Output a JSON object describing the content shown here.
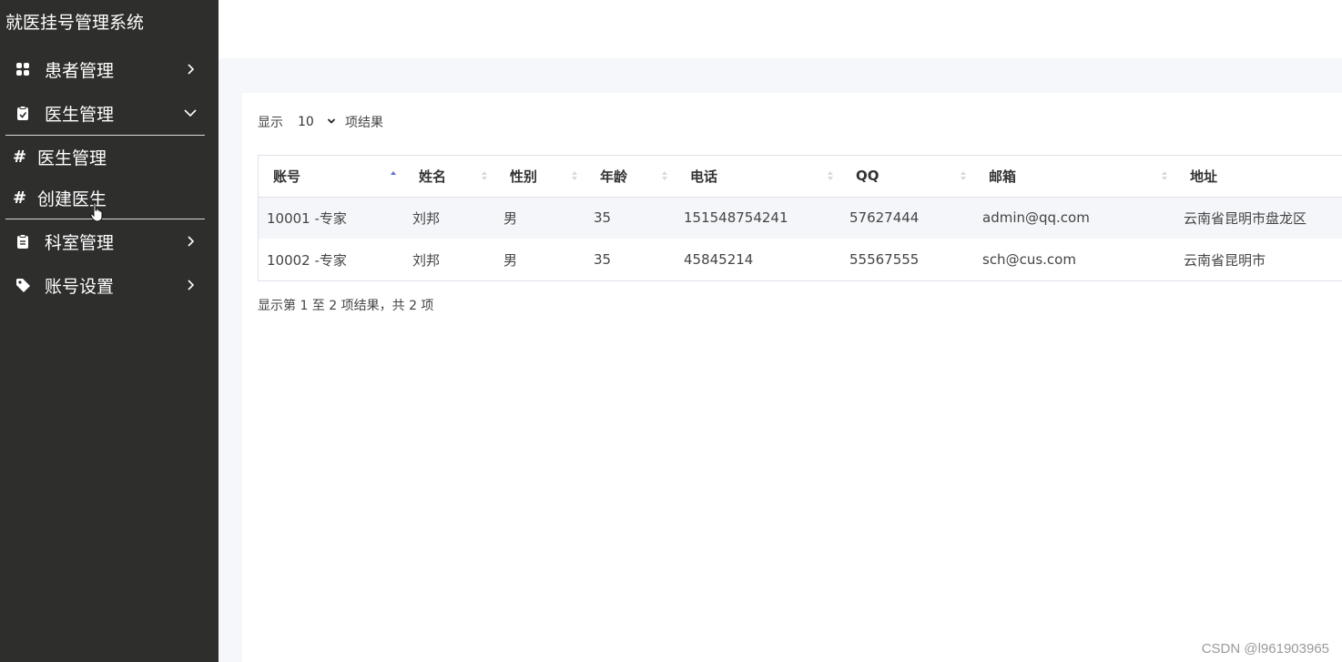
{
  "app": {
    "title": "就医挂号管理系统"
  },
  "sidebar": {
    "items": [
      {
        "label": "患者管理",
        "icon": "grid-icon",
        "expanded": false
      },
      {
        "label": "医生管理",
        "icon": "clipboard-icon",
        "expanded": true,
        "children": [
          {
            "label": "医生管理"
          },
          {
            "label": "创建医生"
          }
        ]
      },
      {
        "label": "科室管理",
        "icon": "clipboard-icon",
        "expanded": false
      },
      {
        "label": "账号设置",
        "icon": "tag-icon",
        "expanded": false
      }
    ]
  },
  "table_controls": {
    "show_label": "显示",
    "page_length": "10",
    "entries_label": "项结果"
  },
  "table": {
    "columns": [
      "账号",
      "姓名",
      "性别",
      "年龄",
      "电话",
      "QQ",
      "邮箱",
      "地址"
    ],
    "sorted_column": "账号",
    "rows": [
      [
        "10001 -专家",
        "刘邦",
        "男",
        "35",
        "151548754241",
        "57627444",
        "admin@qq.com",
        "云南省昆明市盘龙区"
      ],
      [
        "10002 -专家",
        "刘邦",
        "男",
        "35",
        "45845214",
        "55567555",
        "sch@cus.com",
        "云南省昆明市"
      ]
    ]
  },
  "table_info": "显示第 1 至 2 项结果，共 2 项",
  "watermark": "CSDN @l961903965",
  "colors": {
    "sidebar_bg": "#2e2f2d",
    "page_bg": "#f6f7fb",
    "row_stripe": "#f5f6fa",
    "sort_active": "#5b6ee1"
  }
}
